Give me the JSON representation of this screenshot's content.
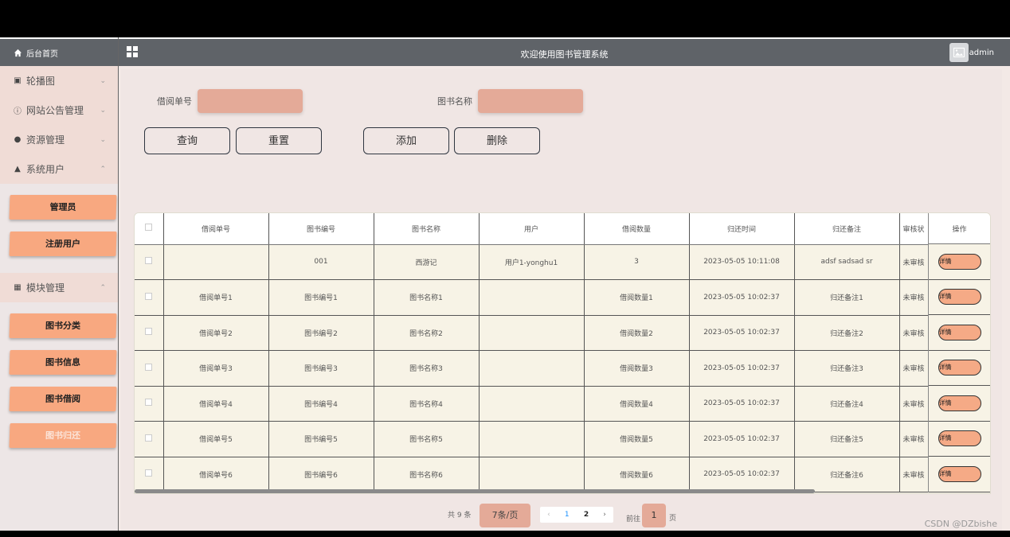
{
  "header": {
    "title": "欢迎使用图书管理系统",
    "user": "admin"
  },
  "sidebar": {
    "home": "后台首页",
    "menus": [
      {
        "label": "轮播图",
        "icon": "image-icon",
        "glyph": "▣",
        "chev": "⌄"
      },
      {
        "label": "网站公告管理",
        "icon": "info-icon",
        "glyph": "ⓘ",
        "chev": "⌄"
      },
      {
        "label": "资源管理",
        "icon": "location-icon",
        "glyph": "●",
        "chev": "⌄"
      },
      {
        "label": "系统用户",
        "icon": "user-icon",
        "glyph": "▲",
        "chev": "⌃"
      }
    ],
    "users_sub": [
      "管理员",
      "注册用户"
    ],
    "module": {
      "label": "模块管理",
      "glyph": "▦",
      "chev": "⌃"
    },
    "module_sub": [
      "图书分类",
      "图书信息",
      "图书借阅",
      "图书归还"
    ]
  },
  "search": {
    "label1": "借阅单号",
    "label2": "图书名称",
    "buttons": [
      "查询",
      "重置",
      "添加",
      "删除"
    ]
  },
  "table": {
    "columns": [
      "借阅单号",
      "图书编号",
      "图书名称",
      "用户",
      "借阅数量",
      "归还时间",
      "归还备注",
      "审核状",
      "操作"
    ],
    "detail_label": "详情",
    "rows": [
      [
        "",
        "001",
        "西游记",
        "用户1-yonghu1",
        "3",
        "2023-05-05 10:11:08",
        "adsf sadsad sr",
        "未审核"
      ],
      [
        "借阅单号1",
        "图书编号1",
        "图书名称1",
        "",
        "借阅数量1",
        "2023-05-05 10:02:37",
        "归还备注1",
        "未审核"
      ],
      [
        "借阅单号2",
        "图书编号2",
        "图书名称2",
        "",
        "借阅数量2",
        "2023-05-05 10:02:37",
        "归还备注2",
        "未审核"
      ],
      [
        "借阅单号3",
        "图书编号3",
        "图书名称3",
        "",
        "借阅数量3",
        "2023-05-05 10:02:37",
        "归还备注3",
        "未审核"
      ],
      [
        "借阅单号4",
        "图书编号4",
        "图书名称4",
        "",
        "借阅数量4",
        "2023-05-05 10:02:37",
        "归还备注4",
        "未审核"
      ],
      [
        "借阅单号5",
        "图书编号5",
        "图书名称5",
        "",
        "借阅数量5",
        "2023-05-05 10:02:37",
        "归还备注5",
        "未审核"
      ],
      [
        "借阅单号6",
        "图书编号6",
        "图书名称6",
        "",
        "借阅数量6",
        "2023-05-05 10:02:37",
        "归还备注6",
        "未审核"
      ]
    ]
  },
  "pagination": {
    "total": "共 9 条",
    "page_size": "7条/页",
    "prev": "‹",
    "pages": [
      "1",
      "2"
    ],
    "next": "›",
    "goto": "前往",
    "current": "1",
    "suffix": "页"
  },
  "watermark": "CSDN @DZbishe"
}
